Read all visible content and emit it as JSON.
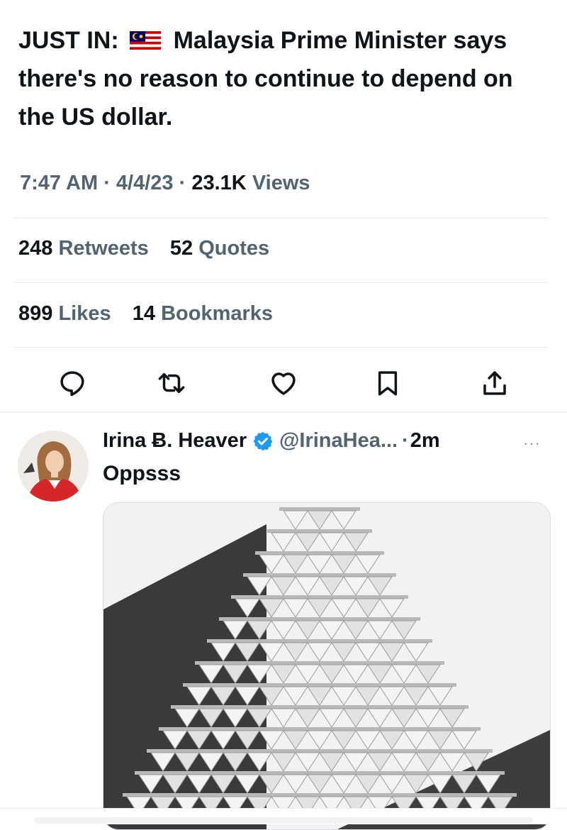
{
  "tweet": {
    "prefix": "JUST IN:",
    "flag_icon": "malaysia-flag-icon",
    "headline": "Malaysia Prime Minister says there's no reason to continue to depend on the US dollar.",
    "time": "7:47 AM",
    "date": "4/4/23",
    "separator": "·",
    "views_count": "23.1K",
    "views_label": "Views"
  },
  "stats": {
    "retweets_count": "248",
    "retweets_label": "Retweets",
    "quotes_count": "52",
    "quotes_label": "Quotes",
    "likes_count": "899",
    "likes_label": "Likes",
    "bookmarks_count": "14",
    "bookmarks_label": "Bookmarks"
  },
  "actions": [
    {
      "icon": "reply-icon"
    },
    {
      "icon": "retweet-icon"
    },
    {
      "icon": "like-icon"
    },
    {
      "icon": "bookmark-icon"
    },
    {
      "icon": "share-icon"
    }
  ],
  "reply": {
    "display_name": "Irina Ƀ. Heaver",
    "verified_icon": "verified-badge-icon",
    "handle": "@IrinaHea...",
    "separator": "·",
    "time": "2m",
    "more": "···",
    "text": "Oppsss",
    "media_icon": "house-of-cards-image"
  },
  "colors": {
    "text": "#0f1419",
    "secondary": "#536471",
    "verified": "#1d9bf0",
    "divider": "#e4e7ea"
  }
}
